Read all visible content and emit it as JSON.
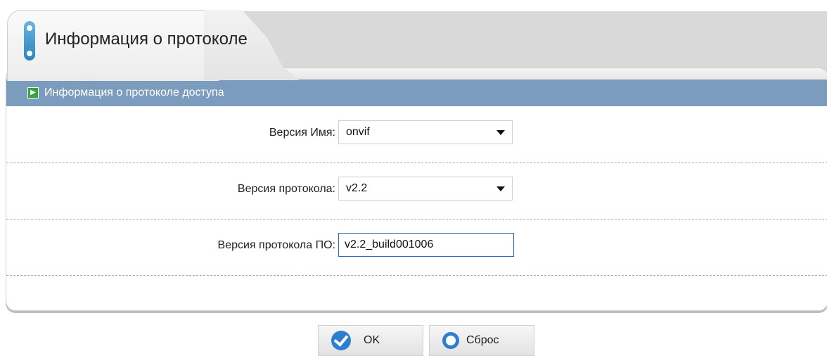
{
  "tab": {
    "title": "Информация о протоколе"
  },
  "section": {
    "title": "Информация о протоколе доступа",
    "icon": "green-arrow-icon"
  },
  "form": {
    "version_name_label": "Версия Имя:",
    "version_name_value": "onvif",
    "protocol_version_label": "Версия протокола:",
    "protocol_version_value": "v2.2",
    "software_version_label": "Версия протокола ПО:",
    "software_version_value": "v2.2_build001006"
  },
  "buttons": {
    "ok_label": "OK",
    "reset_label": "Сброс"
  },
  "colors": {
    "section_bar": "#7c9cbd",
    "accent": "#2c7fd0"
  }
}
